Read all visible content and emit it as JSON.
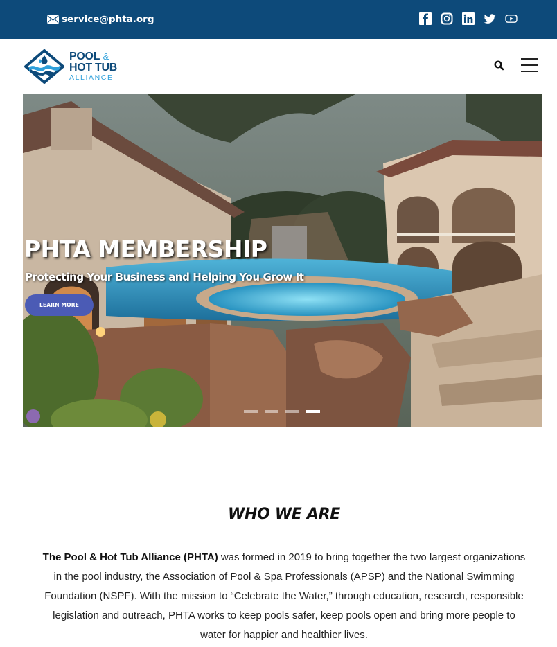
{
  "topbar": {
    "email": "service@phta.org",
    "email_icon": "envelope-icon",
    "social": [
      "facebook-icon",
      "instagram-icon",
      "linkedin-icon",
      "twitter-icon",
      "youtube-icon"
    ],
    "background": "#0d4a7a"
  },
  "header": {
    "logo": {
      "line1": "POOL",
      "amp": "&",
      "line2": "HOT TUB",
      "line3": "ALLIANCE"
    },
    "search_icon": "search-icon",
    "menu_icon": "hamburger-menu-icon"
  },
  "hero": {
    "title": "PHTA MEMBERSHIP",
    "subtitle": "Protecting Your Business and Helping You Grow It",
    "button": "LEARN MORE",
    "slide_count": 4,
    "active_slide": 4,
    "button_color": "#4b5bb5"
  },
  "about": {
    "title": "WHO WE ARE",
    "body_strong": "The Pool & Hot Tub Alliance (PHTA)",
    "body_rest": " was formed in 2019 to bring together the two largest organizations in the pool industry, the Association of Pool & Spa Professionals (APSP) and the National Swimming Foundation (NSPF).  With the mission to “Celebrate the Water,” through education, research, responsible legislation and outreach, PHTA works to keep pools safer, keep pools open and bring more people to water for happier and healthier lives."
  }
}
